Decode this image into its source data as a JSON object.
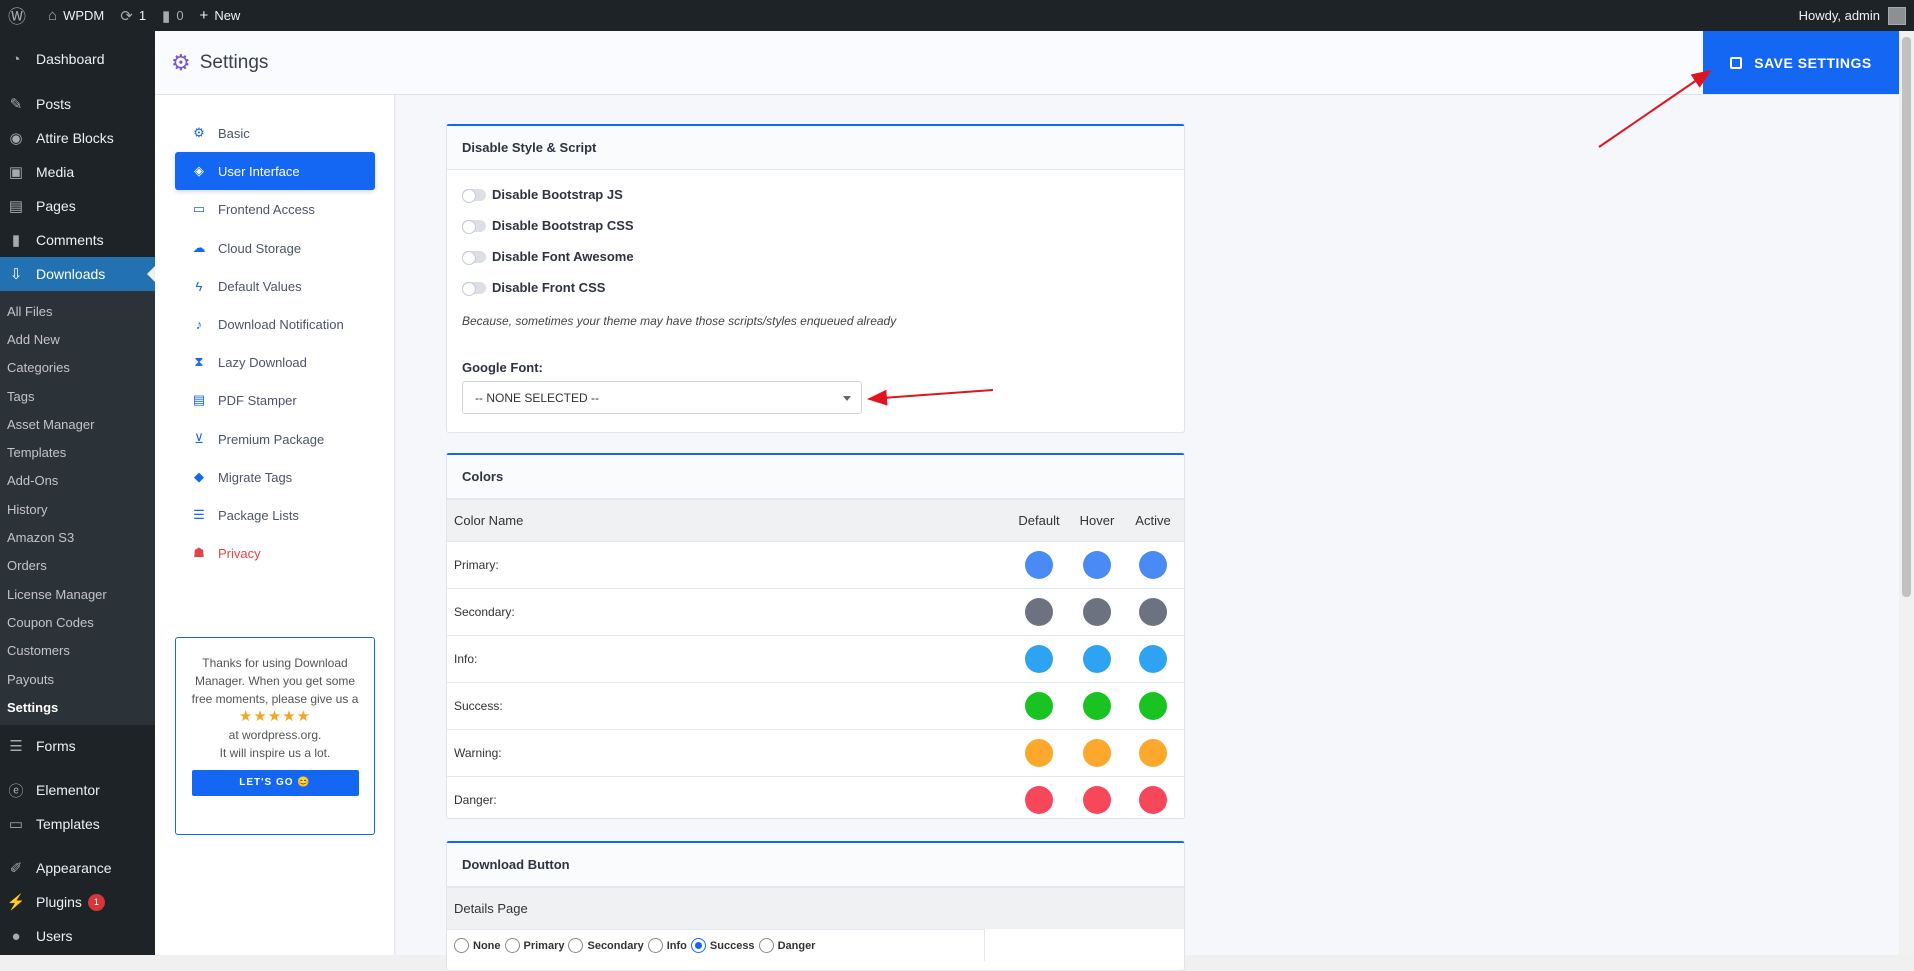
{
  "adminbar": {
    "site": "WPDM",
    "updates": "1",
    "comments": "0",
    "new": "New",
    "howdy": "Howdy, admin"
  },
  "sidebar": {
    "top": [
      {
        "label": "Dashboard",
        "icon": "dashboard-icon"
      }
    ],
    "items": [
      {
        "label": "Posts",
        "icon": "pin-icon"
      },
      {
        "label": "Attire Blocks",
        "icon": "blocks-icon"
      },
      {
        "label": "Media",
        "icon": "media-icon"
      },
      {
        "label": "Pages",
        "icon": "pages-icon"
      },
      {
        "label": "Comments",
        "icon": "comment-icon"
      }
    ],
    "downloads": "Downloads",
    "submenu": [
      "All Files",
      "Add New",
      "Categories",
      "Tags",
      "Asset Manager",
      "Templates",
      "Add-Ons",
      "History",
      "Amazon S3",
      "Orders",
      "License Manager",
      "Coupon Codes",
      "Customers",
      "Payouts",
      "Settings"
    ],
    "bottom": [
      {
        "label": "Forms",
        "icon": "forms-icon"
      },
      {
        "label": "Elementor",
        "icon": "elementor-icon"
      },
      {
        "label": "Templates",
        "icon": "folder-icon"
      },
      {
        "label": "Appearance",
        "icon": "brush-icon"
      },
      {
        "label": "Plugins",
        "icon": "plug-icon",
        "badge": "1"
      },
      {
        "label": "Users",
        "icon": "user-icon"
      }
    ]
  },
  "header": {
    "title": "Settings",
    "save_label": "SAVE SETTINGS"
  },
  "settings_nav": [
    {
      "label": "Basic",
      "icon": "gear-icon"
    },
    {
      "label": "User Interface",
      "icon": "paint-bucket-icon"
    },
    {
      "label": "Frontend Access",
      "icon": "monitor-icon"
    },
    {
      "label": "Cloud Storage",
      "icon": "cloud-icon"
    },
    {
      "label": "Default Values",
      "icon": "bolt-icon"
    },
    {
      "label": "Download Notification",
      "icon": "bell-icon"
    },
    {
      "label": "Lazy Download",
      "icon": "hourglass-icon"
    },
    {
      "label": "PDF Stamper",
      "icon": "pdf-icon"
    },
    {
      "label": "Premium Package",
      "icon": "cart-icon"
    },
    {
      "label": "Migrate Tags",
      "icon": "tags-icon"
    },
    {
      "label": "Package Lists",
      "icon": "list-icon"
    },
    {
      "label": "Privacy",
      "icon": "user-lock-icon"
    }
  ],
  "promo": {
    "line1": "Thanks for using Download Manager. When you get some free moments, please give us a",
    "stars": "★★★★★",
    "line2": "at wordpress.org.",
    "line3": "It will inspire us a lot.",
    "button": "LET'S GO 😊"
  },
  "style_panel": {
    "title": "Disable Style & Script",
    "toggles": [
      "Disable Bootstrap JS",
      "Disable Bootstrap CSS",
      "Disable Font Awesome",
      "Disable Front CSS"
    ],
    "note": "Because, sometimes your theme may have those scripts/styles enqueued already",
    "font_label": "Google Font:",
    "font_value": "-- NONE SELECTED --"
  },
  "colors_panel": {
    "title": "Colors",
    "headers": {
      "name": "Color Name",
      "default": "Default",
      "hover": "Hover",
      "active": "Active"
    },
    "rows": [
      {
        "label": "Primary:",
        "color": "#4a8af4"
      },
      {
        "label": "Secondary:",
        "color": "#6c7280"
      },
      {
        "label": "Info:",
        "color": "#2ea3f2"
      },
      {
        "label": "Success:",
        "color": "#18c322"
      },
      {
        "label": "Warning:",
        "color": "#fba82c"
      },
      {
        "label": "Danger:",
        "color": "#f7475b"
      }
    ]
  },
  "download_panel": {
    "title": "Download Button",
    "sub": "Details Page",
    "options": [
      "None",
      "Primary",
      "Secondary",
      "Info",
      "Success",
      "Danger"
    ],
    "selected": "Success"
  },
  "colors": {
    "accent": "#1467f3",
    "wp_blue": "#2271b1",
    "annotation": "#e0141e"
  }
}
